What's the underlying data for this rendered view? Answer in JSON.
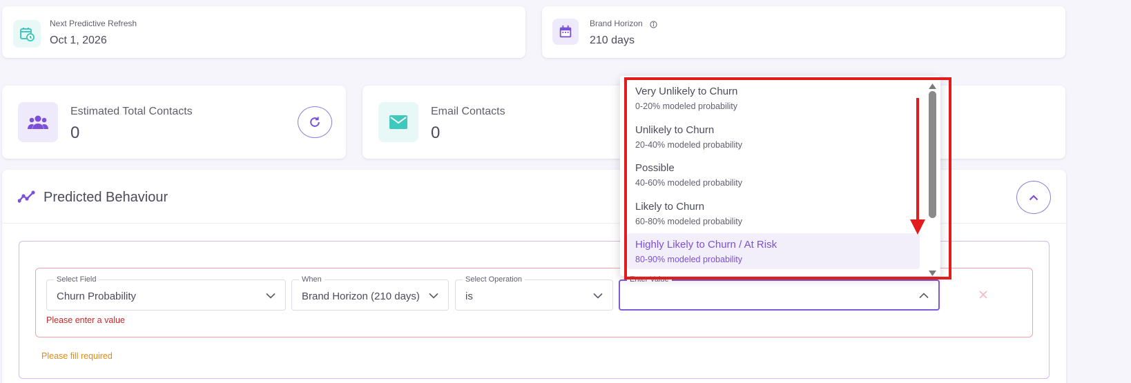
{
  "top_cards": [
    {
      "label": "Next Predictive Refresh",
      "value": "Oct 1, 2026",
      "icon": "calendar-clock-icon"
    },
    {
      "label": "Brand Horizon",
      "value": "210 days",
      "icon": "calendar-icon",
      "info_icon": "info-icon"
    }
  ],
  "stat_cards": [
    {
      "label": "Estimated Total Contacts",
      "value": "0",
      "icon": "users-icon",
      "action_icon": "refresh-icon"
    },
    {
      "label": "Email Contacts",
      "value": "0",
      "icon": "mail-icon"
    }
  ],
  "section": {
    "title": "Predicted Behaviour",
    "icon": "trend-line-icon",
    "toggle_icon": "chevron-up-icon"
  },
  "rule": {
    "select_field": {
      "label": "Select Field",
      "value": "Churn Probability"
    },
    "when": {
      "label": "When",
      "value": "Brand Horizon (210 days)"
    },
    "operation": {
      "label": "Select Operation",
      "value": "is"
    },
    "value_input": {
      "label": "Enter Value",
      "value": ""
    },
    "remove_icon": "close-icon",
    "value_error": "Please enter a value",
    "group_warning": "Please fill required"
  },
  "dropdown": {
    "options": [
      {
        "title": "Very Unlikely to Churn",
        "subtitle": "0-20% modeled probability",
        "selected": false
      },
      {
        "title": "Unlikely to Churn",
        "subtitle": "20-40% modeled probability",
        "selected": false
      },
      {
        "title": "Possible",
        "subtitle": "40-60% modeled probability",
        "selected": false
      },
      {
        "title": "Likely to Churn",
        "subtitle": "60-80% modeled probability",
        "selected": false
      },
      {
        "title": "Highly Likely to Churn / At Risk",
        "subtitle": "80-90% modeled probability",
        "selected": true
      }
    ]
  },
  "colors": {
    "accent": "#7b5bd6",
    "teal": "#4ecdc4",
    "error": "#c62828",
    "warning": "#e08a1c",
    "annotation": "#e01c1c"
  }
}
